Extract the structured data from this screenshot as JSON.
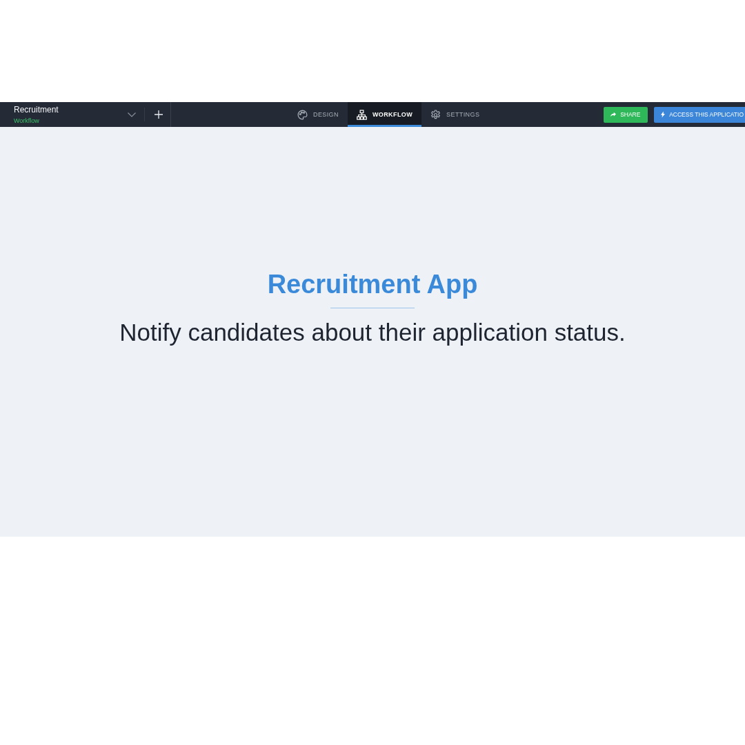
{
  "header": {
    "app_name": "Recruitment",
    "section": "Workflow",
    "tabs": [
      {
        "label": "DESIGN",
        "selected": false
      },
      {
        "label": "WORKFLOW",
        "selected": true
      },
      {
        "label": "SETTINGS",
        "selected": false
      }
    ],
    "buttons": [
      {
        "label": "SHARE",
        "kind": "share"
      },
      {
        "label": "ACCESS THIS APPLICATIO",
        "kind": "access"
      }
    ]
  },
  "content": {
    "title": "Recruitment App",
    "subtitle": "Notify candidates about their application status."
  }
}
